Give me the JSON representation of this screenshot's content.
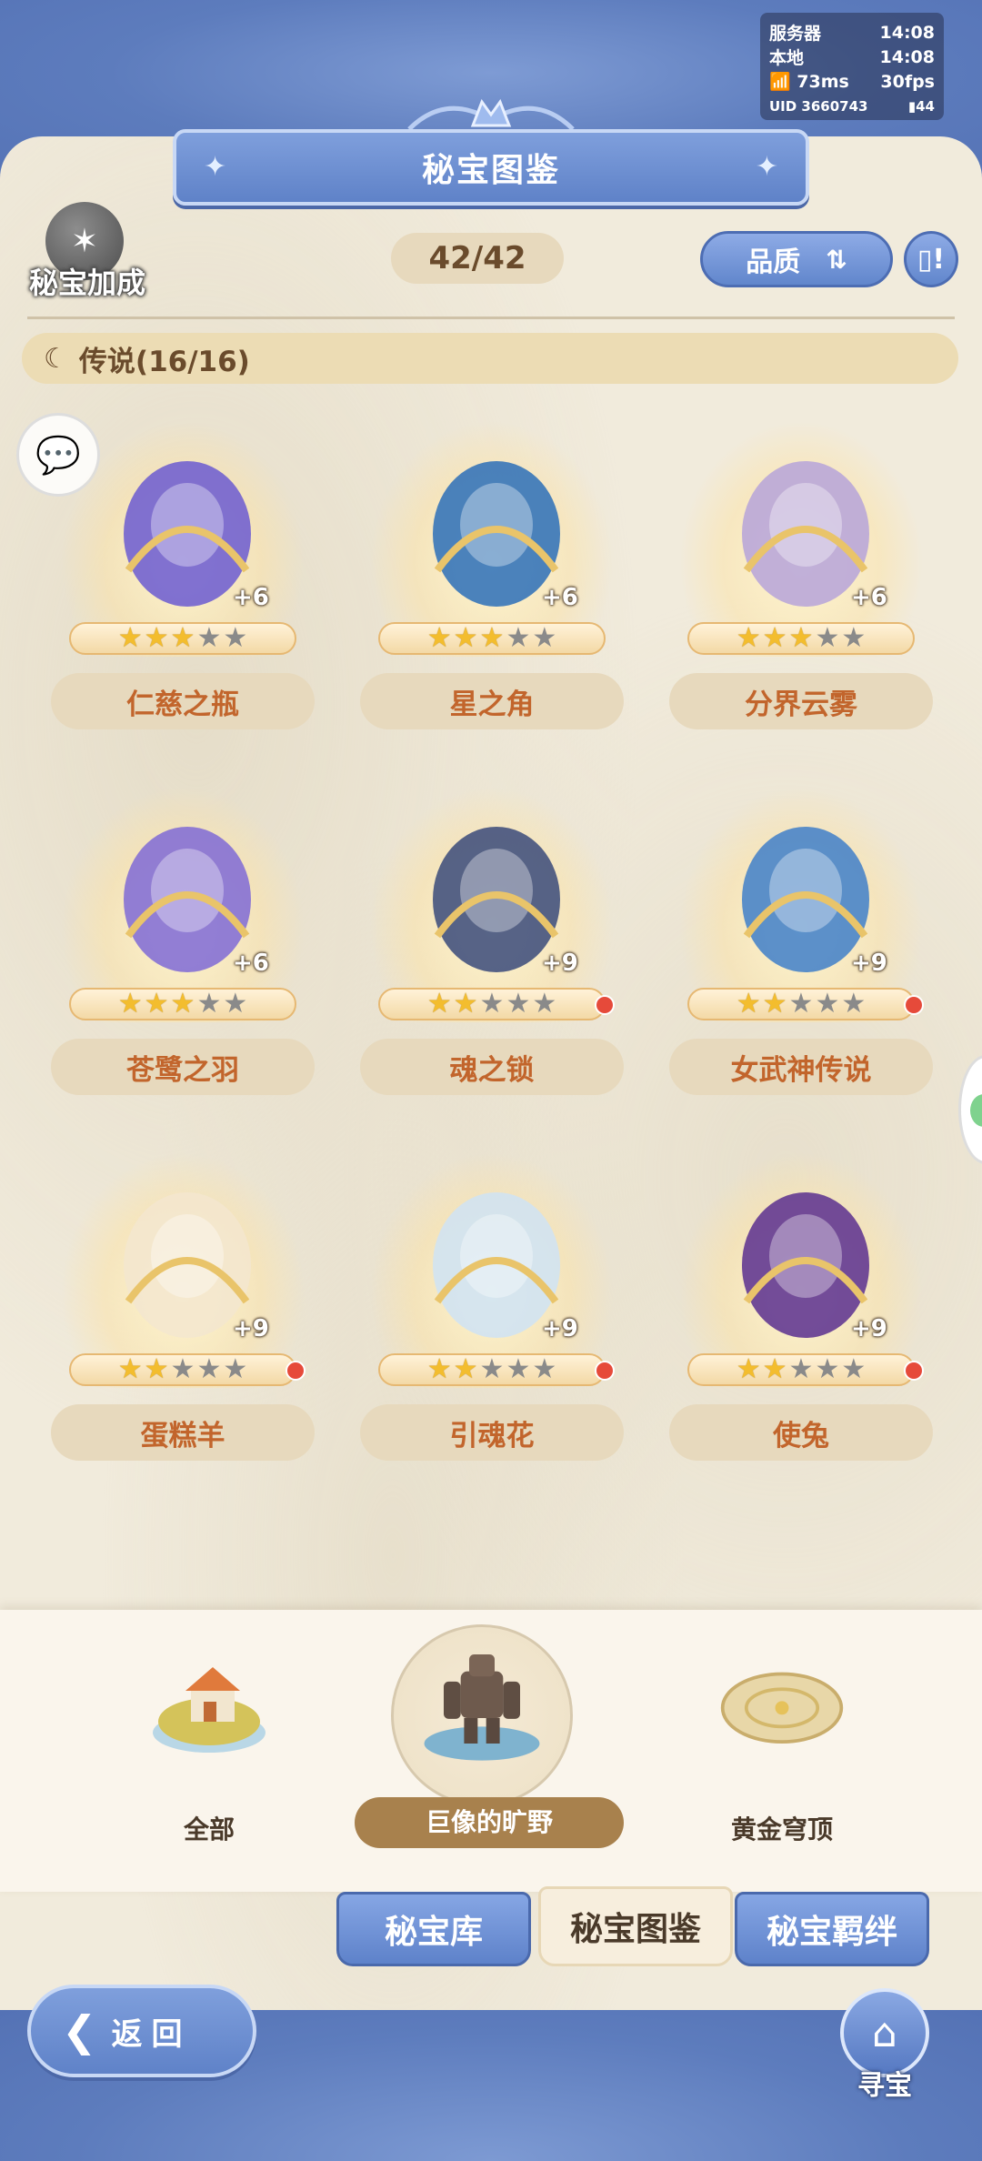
{
  "status": {
    "server_label": "服务器",
    "server_time": "14:08",
    "local_label": "本地",
    "local_time": "14:08",
    "ping": "73ms",
    "fps": "30fps",
    "uid": "UID 3660743",
    "battery": "44"
  },
  "header": {
    "title": "秘宝图鉴",
    "bonus_label": "秘宝加成",
    "counter": "42/42",
    "quality_label": "品质"
  },
  "category": {
    "label": "传说(16/16)"
  },
  "items": [
    {
      "name": "仁慈之瓶",
      "plus": "+6",
      "stars": 3,
      "dot": false,
      "icon": "vial-icon"
    },
    {
      "name": "星之角",
      "plus": "+6",
      "stars": 3,
      "dot": false,
      "icon": "star-horn-icon"
    },
    {
      "name": "分界云雾",
      "plus": "+6",
      "stars": 3,
      "dot": false,
      "icon": "cloud-mist-icon"
    },
    {
      "name": "苍鹭之羽",
      "plus": "+6",
      "stars": 3,
      "dot": false,
      "icon": "feather-icon"
    },
    {
      "name": "魂之锁",
      "plus": "+9",
      "stars": 2,
      "dot": true,
      "icon": "chain-lock-icon"
    },
    {
      "name": "女武神传说",
      "plus": "+9",
      "stars": 2,
      "dot": true,
      "icon": "tome-icon"
    },
    {
      "name": "蛋糕羊",
      "plus": "+9",
      "stars": 2,
      "dot": true,
      "icon": "sheep-icon"
    },
    {
      "name": "引魂花",
      "plus": "+9",
      "stars": 2,
      "dot": true,
      "icon": "flower-icon"
    },
    {
      "name": "使兔",
      "plus": "+9",
      "stars": 2,
      "dot": true,
      "icon": "dark-rabbit-icon"
    }
  ],
  "regions": [
    {
      "label": "全部",
      "selected": false
    },
    {
      "label": "巨像的旷野",
      "selected": true
    },
    {
      "label": "黄金穹顶",
      "selected": false
    }
  ],
  "tabs": [
    {
      "label": "秘宝库",
      "active": false
    },
    {
      "label": "秘宝图鉴",
      "active": true
    },
    {
      "label": "秘宝羁绊",
      "active": false
    }
  ],
  "footer": {
    "back_label": "返回",
    "treasure_label": "寻宝"
  },
  "colors": {
    "frame_blue": "#5f7fc0",
    "panel_beige": "#f1ebdc",
    "name_text": "#c2652c",
    "star_gold": "#f3bd2e",
    "badge_red": "#e64a3a"
  }
}
